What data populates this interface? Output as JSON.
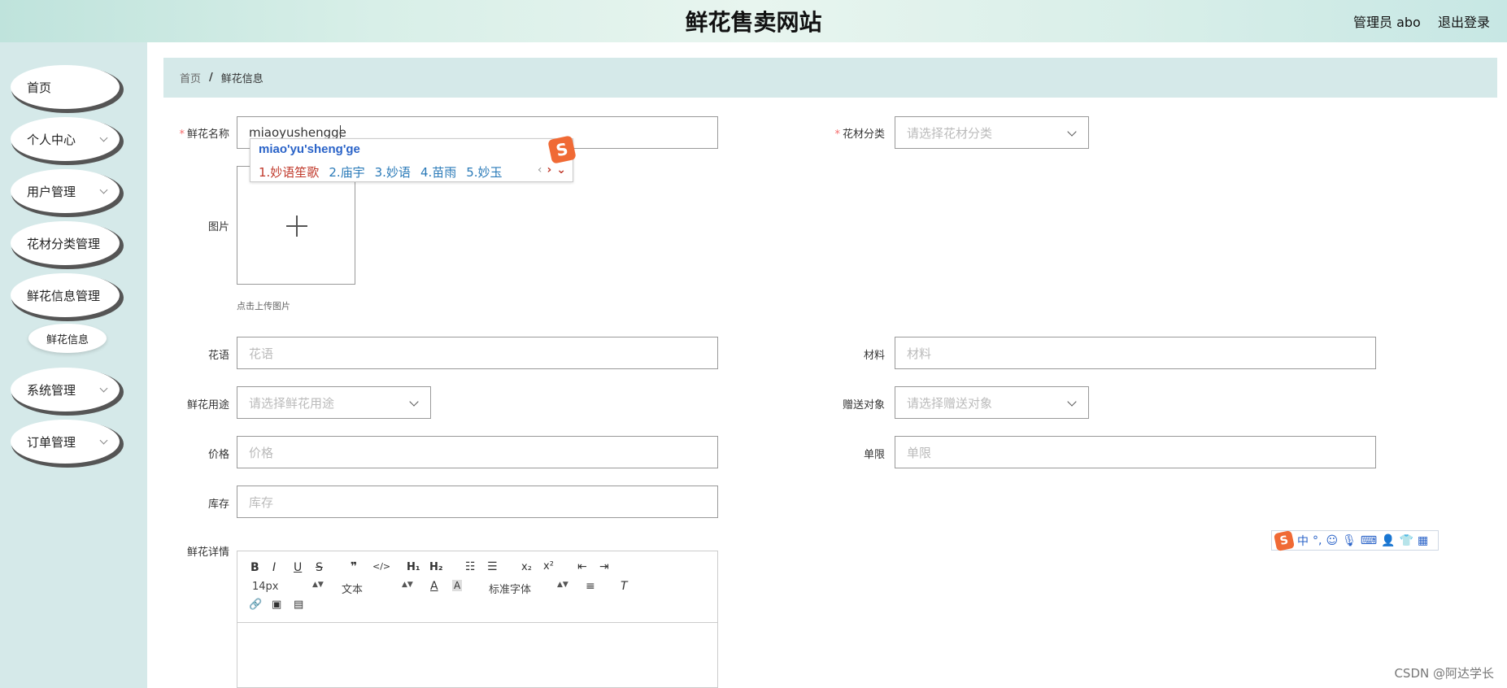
{
  "header": {
    "title": "鲜花售卖网站",
    "admin": "管理员 abo",
    "logout": "退出登录"
  },
  "sidebar": {
    "items": [
      {
        "label": "首页"
      },
      {
        "label": "个人中心"
      },
      {
        "label": "用户管理"
      },
      {
        "label": "花材分类管理"
      },
      {
        "label": "鲜花信息管理"
      },
      {
        "label": "系统管理"
      },
      {
        "label": "订单管理"
      }
    ],
    "subitem": "鲜花信息"
  },
  "breadcrumb": {
    "home": "首页",
    "sep": "/",
    "current": "鲜花信息"
  },
  "form": {
    "name_label": "鲜花名称",
    "name_value": "miaoyushengge",
    "category_label": "花材分类",
    "category_placeholder": "请选择花材分类",
    "image_label": "图片",
    "image_hint": "点击上传图片",
    "language_label": "花语",
    "language_placeholder": "花语",
    "material_label": "材料",
    "material_placeholder": "材料",
    "usage_label": "鲜花用途",
    "usage_placeholder": "请选择鲜花用途",
    "target_label": "赠送对象",
    "target_placeholder": "请选择赠送对象",
    "price_label": "价格",
    "price_placeholder": "价格",
    "unit_label": "单限",
    "unit_placeholder": "单限",
    "stock_label": "库存",
    "stock_placeholder": "库存",
    "detail_label": "鲜花详情"
  },
  "ime": {
    "pinyin": "miao'yu'sheng'ge",
    "candidates": [
      "1.妙语笙歌",
      "2.庙宇",
      "3.妙语",
      "4.苗雨",
      "5.妙玉"
    ],
    "logo": "S"
  },
  "editor": {
    "font_size": "14px",
    "paragraph": "文本",
    "font_family": "标准字体"
  },
  "watermark": "CSDN @阿达学长"
}
